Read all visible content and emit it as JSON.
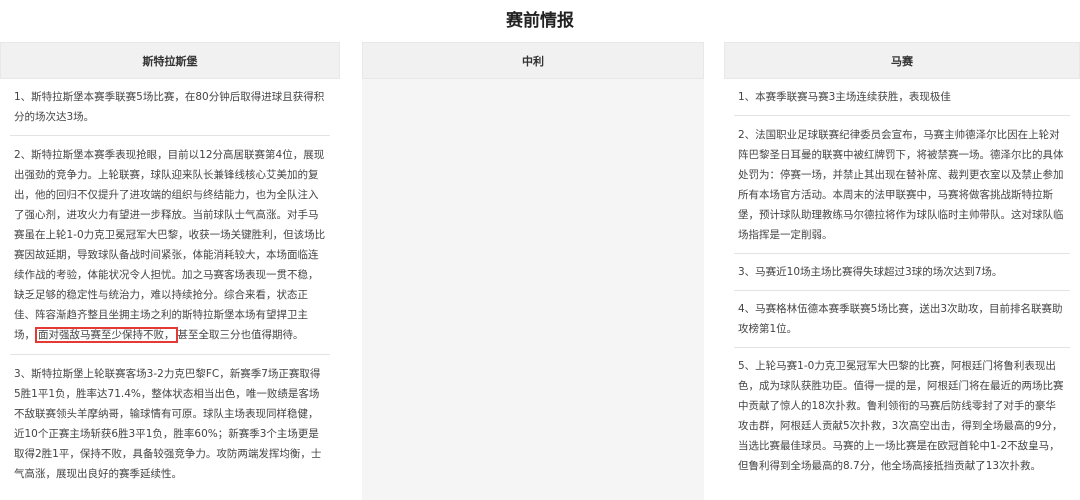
{
  "page_title": "赛前情报",
  "columns": {
    "left": {
      "header": "斯特拉斯堡",
      "items": [
        "1、斯特拉斯堡本赛季联赛5场比赛，在80分钟后取得进球且获得积分的场次达3场。",
        "2、斯特拉斯堡本赛季表现抢眼，目前以12分高居联赛第4位，展现出强劲的竞争力。上轮联赛，球队迎来队长兼锋线核心艾美加的复出，他的回归不仅提升了进攻端的组织与终结能力，也为全队注入了强心剂，进攻火力有望进一步释放。当前球队士气高涨。对手马赛虽在上轮1-0力克卫冕冠军大巴黎，收获一场关键胜利，但该场比赛因故延期，导致球队备战时间紧张，体能消耗较大，本场面临连续作战的考验，体能状况令人担忧。加之马赛客场表现一贯不稳，缺乏足够的稳定性与统治力，难以持续抢分。综合来看，状态正佳、阵容渐趋齐整且坐拥主场之利的斯特拉斯堡本场有望捍卫主场，",
        "3、斯特拉斯堡上轮联赛客场3-2力克巴黎FC，新赛季7场正赛取得5胜1平1负，胜率达71.4%，整体状态相当出色，唯一败绩是客场不敌联赛领头羊摩纳哥，输球情有可原。球队主场表现同样稳健，近10个正赛主场斩获6胜3平1负，胜率60%；新赛季3个主场更是取得2胜1平，保持不败，具备较强竞争力。攻防两端发挥均衡，士气高涨，展现出良好的赛季延续性。"
      ],
      "highlight": "面对强敌马赛至少保持不败，",
      "item2_tail": "甚至全取三分也值得期待。"
    },
    "middle": {
      "header": "中利"
    },
    "right": {
      "header": "马赛",
      "items": [
        "1、本赛季联赛马赛3主场连续获胜，表现极佳",
        "2、法国职业足球联赛纪律委员会宣布，马赛主帅德泽尔比因在上轮对阵巴黎圣日耳曼的联赛中被红牌罚下，将被禁赛一场。德泽尔比的具体处罚为：停赛一场，并禁止其出现在替补席、裁判更衣室以及禁止参加所有本场官方活动。本周末的法甲联赛中，马赛将做客挑战斯特拉斯堡，预计球队助理教练马尔德拉将作为球队临时主帅带队。这对球队临场指挥是一定削弱。",
        "3、马赛近10场主场比赛得失球超过3球的场次达到7场。",
        "4、马赛格林伍德本赛季联赛5场比赛，送出3次助攻，目前排名联赛助攻榜第1位。",
        "5、上轮马赛1-0力克卫冕冠军大巴黎的比赛，阿根廷门将鲁利表现出色，成为球队获胜功臣。值得一提的是，阿根廷门将在最近的两场比赛中贡献了惊人的18次扑救。鲁利领衔的马赛后防线零封了对手的豪华攻击群，阿根廷人贡献5次扑救，3次高空出击，得到全场最高的9分，当选比赛最佳球员。马赛的上一场比赛是在欧冠首轮中1-2不敌皇马，但鲁利得到全场最高的8.7分，他全场高接抵挡贡献了13次扑救。"
      ]
    }
  }
}
